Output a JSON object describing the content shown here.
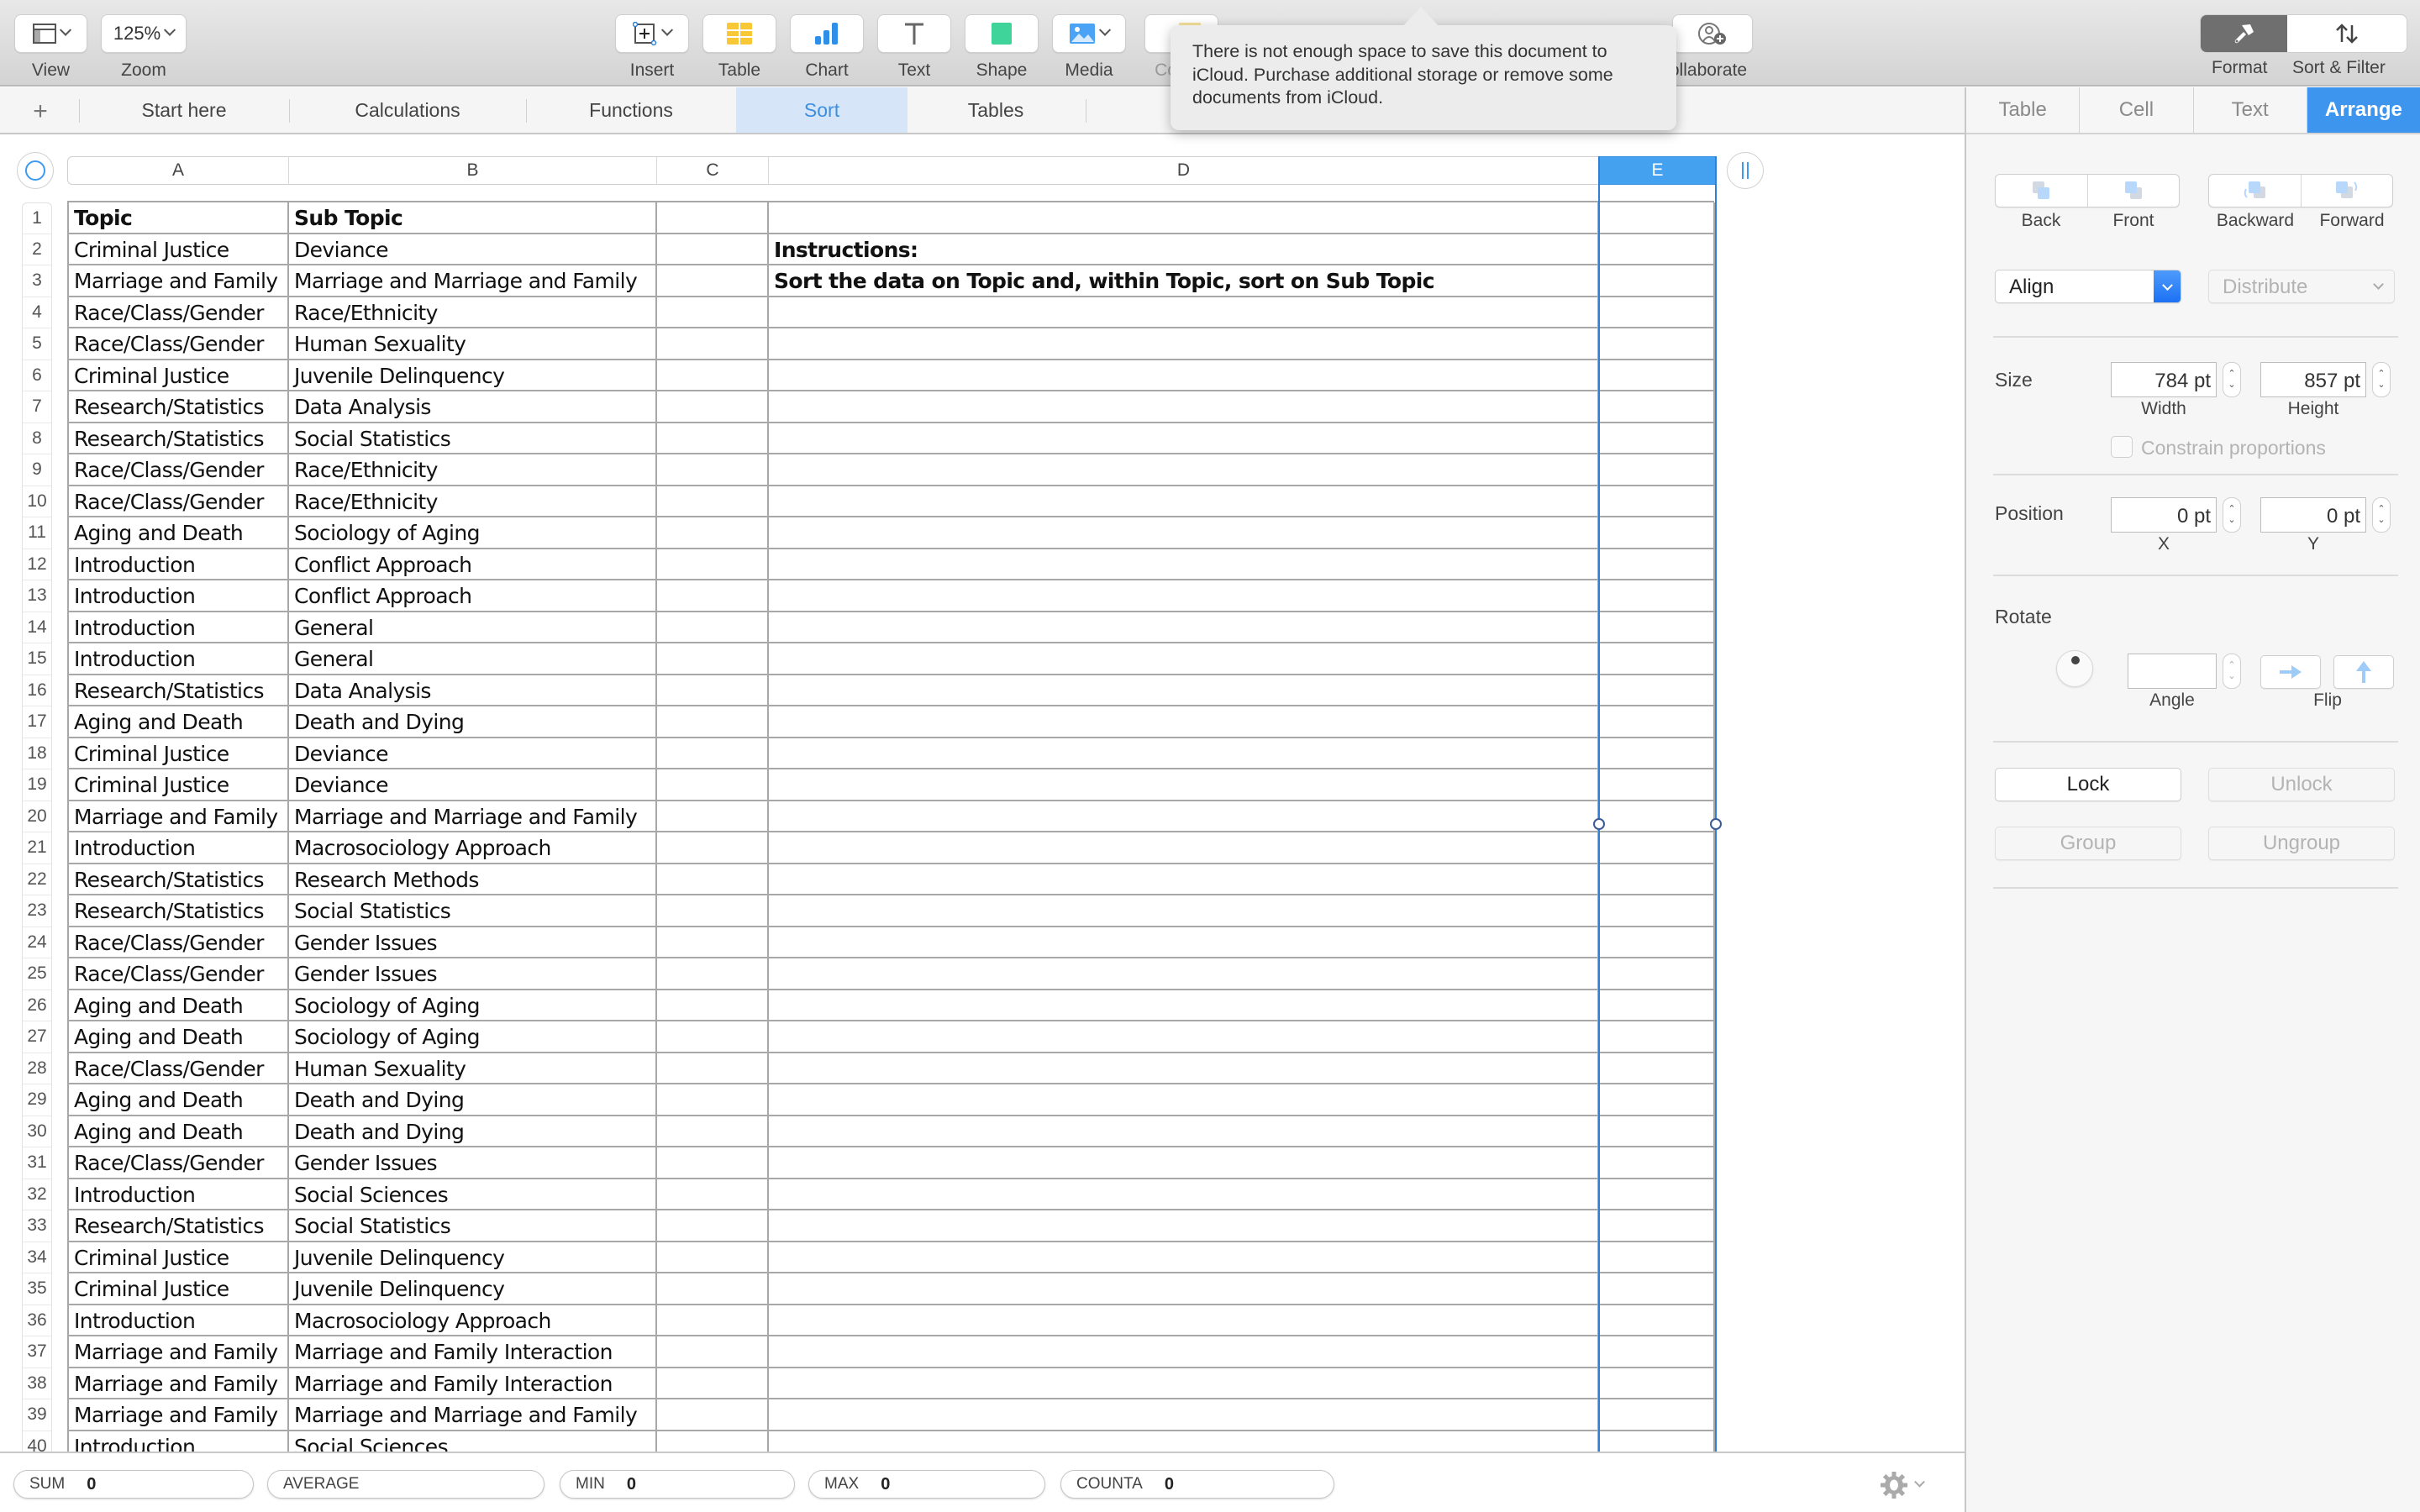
{
  "toolbar": {
    "view_label": "View",
    "zoom_value": "125%",
    "zoom_label": "Zoom",
    "insert_label": "Insert",
    "table_label": "Table",
    "chart_label": "Chart",
    "text_label": "Text",
    "shape_label": "Shape",
    "media_label": "Media",
    "comment_label": "Cor",
    "collaborate_label": "ollaborate",
    "format_label": "Format",
    "sort_filter_label": "Sort & Filter"
  },
  "tooltip": {
    "message": "There is not enough space to save this document to iCloud. Purchase additional storage or remove some documents from iCloud."
  },
  "sheet_tabs": [
    {
      "label": "Start here",
      "active": false
    },
    {
      "label": "Calculations",
      "active": false
    },
    {
      "label": "Functions",
      "active": false
    },
    {
      "label": "Sort",
      "active": true
    },
    {
      "label": "Tables",
      "active": false
    }
  ],
  "inspector": {
    "tabs": [
      {
        "label": "Table",
        "active": false
      },
      {
        "label": "Cell",
        "active": false
      },
      {
        "label": "Text",
        "active": false
      },
      {
        "label": "Arrange",
        "active": true
      }
    ],
    "back_label": "Back",
    "front_label": "Front",
    "backward_label": "Backward",
    "forward_label": "Forward",
    "align_label": "Align",
    "distribute_label": "Distribute",
    "size_title": "Size",
    "width_value": "784 pt",
    "width_label": "Width",
    "height_value": "857 pt",
    "height_label": "Height",
    "constrain_label": "Constrain proportions",
    "constrain_checked": false,
    "position_title": "Position",
    "x_value": "0 pt",
    "x_label": "X",
    "y_value": "0 pt",
    "y_label": "Y",
    "rotate_title": "Rotate",
    "angle_value": "",
    "angle_label": "Angle",
    "flip_label": "Flip",
    "lock_label": "Lock",
    "unlock_label": "Unlock",
    "group_label": "Group",
    "ungroup_label": "Ungroup"
  },
  "grid": {
    "columns": [
      "A",
      "B",
      "C",
      "D",
      "E"
    ],
    "selected_column": "E",
    "instructions_title": "Instructions:",
    "instructions_text": "Sort the data on Topic and, within Topic, sort on Sub Topic",
    "rows": [
      [
        "Topic",
        "Sub Topic"
      ],
      [
        "Criminal Justice",
        "Deviance"
      ],
      [
        "Marriage and Family",
        "Marriage and Marriage and Family"
      ],
      [
        "Race/Class/Gender",
        "Race/Ethnicity"
      ],
      [
        "Race/Class/Gender",
        "Human Sexuality"
      ],
      [
        "Criminal Justice",
        "Juvenile Delinquency"
      ],
      [
        "Research/Statistics",
        "Data Analysis"
      ],
      [
        "Research/Statistics",
        "Social Statistics"
      ],
      [
        "Race/Class/Gender",
        "Race/Ethnicity"
      ],
      [
        "Race/Class/Gender",
        "Race/Ethnicity"
      ],
      [
        "Aging and Death",
        "Sociology of Aging"
      ],
      [
        "Introduction",
        "Conflict Approach"
      ],
      [
        "Introduction",
        "Conflict Approach"
      ],
      [
        "Introduction",
        "General"
      ],
      [
        "Introduction",
        "General"
      ],
      [
        "Research/Statistics",
        "Data Analysis"
      ],
      [
        "Aging and Death",
        "Death and Dying"
      ],
      [
        "Criminal Justice",
        "Deviance"
      ],
      [
        "Criminal Justice",
        "Deviance"
      ],
      [
        "Marriage and Family",
        "Marriage and Marriage and Family"
      ],
      [
        "Introduction",
        "Macrosociology Approach"
      ],
      [
        "Research/Statistics",
        "Research Methods"
      ],
      [
        "Research/Statistics",
        "Social Statistics"
      ],
      [
        "Race/Class/Gender",
        "Gender Issues"
      ],
      [
        "Race/Class/Gender",
        "Gender Issues"
      ],
      [
        "Aging and Death",
        "Sociology of Aging"
      ],
      [
        "Aging and Death",
        "Sociology of Aging"
      ],
      [
        "Race/Class/Gender",
        "Human Sexuality"
      ],
      [
        "Aging and Death",
        "Death and Dying"
      ],
      [
        "Aging and Death",
        "Death and Dying"
      ],
      [
        "Race/Class/Gender",
        "Gender Issues"
      ],
      [
        "Introduction",
        "Social Sciences"
      ],
      [
        "Research/Statistics",
        "Social Statistics"
      ],
      [
        "Criminal Justice",
        "Juvenile Delinquency"
      ],
      [
        "Criminal Justice",
        "Juvenile Delinquency"
      ],
      [
        "Introduction",
        "Macrosociology Approach"
      ],
      [
        "Marriage and Family",
        "Marriage and Family Interaction"
      ],
      [
        "Marriage and Family",
        "Marriage and Family Interaction"
      ],
      [
        "Marriage and Family",
        "Marriage and Marriage and Family"
      ],
      [
        "Introduction",
        "Social Sciences"
      ]
    ]
  },
  "statusbar": {
    "sum_label": "SUM",
    "sum_value": "0",
    "average_label": "AVERAGE",
    "average_value": "",
    "min_label": "MIN",
    "min_value": "0",
    "max_label": "MAX",
    "max_value": "0",
    "counta_label": "COUNTA",
    "counta_value": "0"
  },
  "colors": {
    "accent": "#3e95ee",
    "active_tab_bg": "#d6e6f8",
    "selection": "#2f7fd8"
  }
}
